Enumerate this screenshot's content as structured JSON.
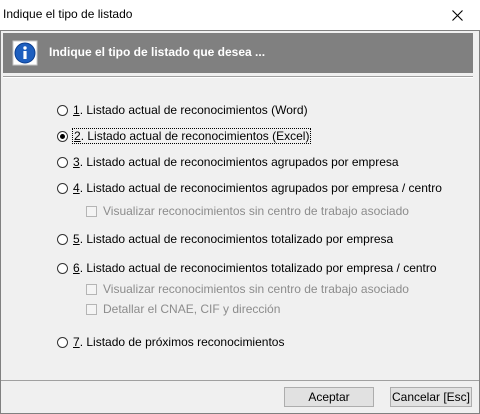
{
  "window": {
    "title": "Indique el tipo de listado"
  },
  "header": {
    "icon": "info-icon",
    "text": "Indique el tipo de listado que desea ..."
  },
  "options": [
    {
      "key": "1",
      "label": ". Listado actual de reconocimientos (Word)",
      "checked": false
    },
    {
      "key": "2",
      "label": ". Listado actual de reconocimientos (Excel)",
      "checked": true
    },
    {
      "key": "3",
      "label": ". Listado actual de reconocimientos agrupados por empresa",
      "checked": false
    },
    {
      "key": "4",
      "label": ". Listado actual de reconocimientos agrupados por empresa / centro",
      "checked": false
    },
    {
      "key": "5",
      "label": ". Listado actual de reconocimientos totalizado por empresa",
      "checked": false
    },
    {
      "key": "6",
      "label": ". Listado actual de reconocimientos totalizado por empresa / centro",
      "checked": false
    },
    {
      "key": "7",
      "label": ". Listado de próximos reconocimientos",
      "checked": false
    }
  ],
  "sub_options": {
    "opt4_visualizar": "Visualizar reconocimientos sin centro de trabajo asociado",
    "opt6_visualizar": "Visualizar reconocimientos sin centro de trabajo asociado",
    "opt6_detallar": "Detallar el CNAE, CIF y dirección"
  },
  "buttons": {
    "accept": "Aceptar",
    "cancel": "Cancelar  [Esc]"
  }
}
